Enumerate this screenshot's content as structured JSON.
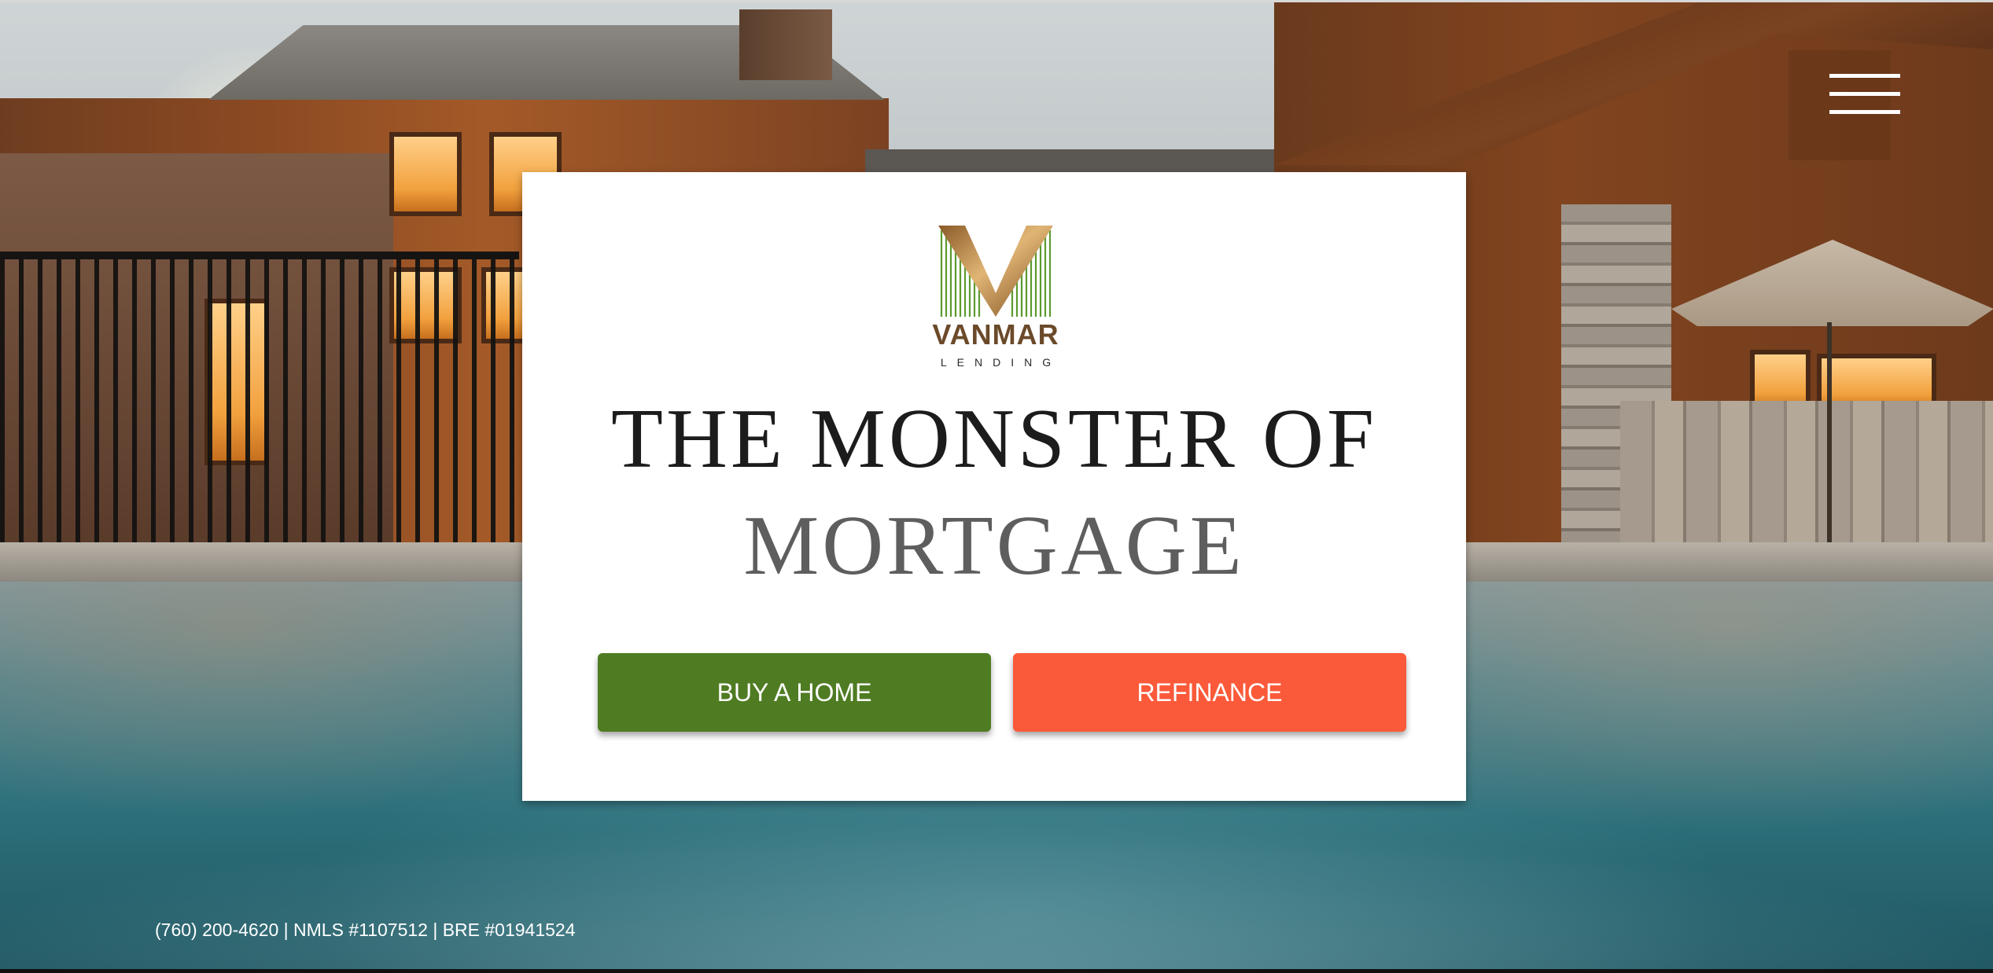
{
  "menu": {
    "icon": "hamburger-menu-icon"
  },
  "brand": {
    "name": "VANMAR",
    "tagline": "LENDING",
    "colors": {
      "gold": "#b07a3a",
      "green": "#5c9a2e",
      "brown": "#6b4a2a"
    }
  },
  "hero": {
    "headline_line1": "THE MONSTER OF",
    "headline_line2": "MORTGAGE"
  },
  "buttons": {
    "buy_label": "BUY A HOME",
    "buy_color": "#4f7c22",
    "refinance_label": "REFINANCE",
    "refinance_color": "#fb5a3a"
  },
  "footer": {
    "contact": "(760) 200-4620 | NMLS #1107512 | BRE #01941524"
  }
}
